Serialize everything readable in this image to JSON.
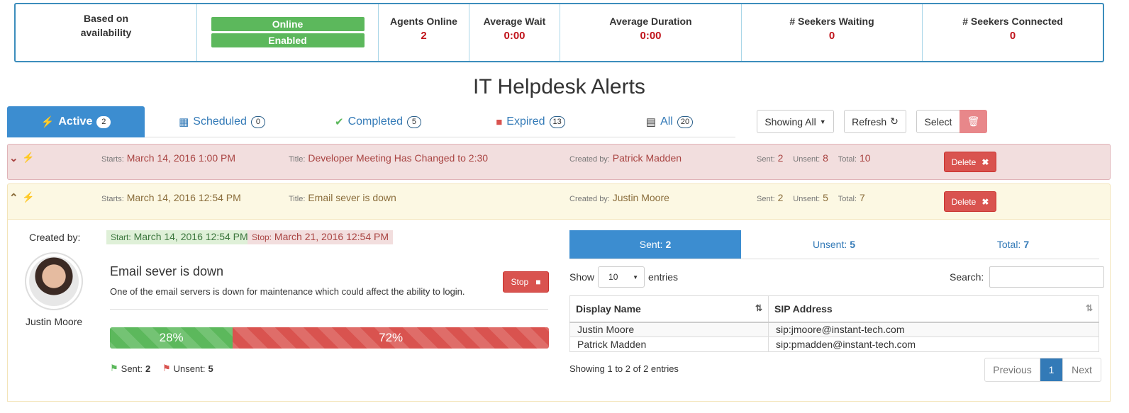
{
  "status_bar": {
    "availability_label": "Based on availability",
    "online_label": "Online",
    "enabled_label": "Enabled",
    "agents_online": {
      "label": "Agents Online",
      "value": "2"
    },
    "average_wait": {
      "label": "Average Wait",
      "value": "0:00"
    },
    "average_duration": {
      "label": "Average Duration",
      "value": "0:00"
    },
    "seekers_waiting": {
      "label": "# Seekers Waiting",
      "value": "0"
    },
    "seekers_connected": {
      "label": "# Seekers Connected",
      "value": "0"
    }
  },
  "page_title": "IT Helpdesk Alerts",
  "tabs": [
    {
      "label": "Active",
      "count": "2",
      "icon": "bolt-icon"
    },
    {
      "label": "Scheduled",
      "count": "0",
      "icon": "calendar-icon"
    },
    {
      "label": "Completed",
      "count": "5",
      "icon": "check-icon"
    },
    {
      "label": "Expired",
      "count": "13",
      "icon": "stop-square-icon"
    },
    {
      "label": "All",
      "count": "20",
      "icon": "list-icon"
    }
  ],
  "toolbar": {
    "showing_label": "Showing All",
    "refresh_label": "Refresh",
    "select_label": "Select"
  },
  "alerts": [
    {
      "starts_label": "Starts:",
      "starts": "March 14, 2016 1:00 PM",
      "title_label": "Title:",
      "title": "Developer Meeting Has Changed to 2:30",
      "created_label": "Created by:",
      "created_by": "Patrick Madden",
      "sent_label": "Sent:",
      "sent": "2",
      "unsent_label": "Unsent:",
      "unsent": "8",
      "total_label": "Total:",
      "total": "10",
      "delete_label": "Delete"
    },
    {
      "starts_label": "Starts:",
      "starts": "March 14, 2016 12:54 PM",
      "title_label": "Title:",
      "title": "Email sever is down",
      "created_label": "Created by:",
      "created_by": "Justin Moore",
      "sent_label": "Sent:",
      "sent": "2",
      "unsent_label": "Unsent:",
      "unsent": "5",
      "total_label": "Total:",
      "total": "7",
      "delete_label": "Delete"
    }
  ],
  "detail": {
    "created_by_label": "Created by:",
    "person_name": "Justin Moore",
    "start_label": "Start:",
    "start": "March 14, 2016 12:54 PM",
    "stop_label": "Stop:",
    "stop": "March 21, 2016 12:54 PM",
    "message_title": "Email sever is down",
    "message_body": "One of the email servers is down for maintenance which could affect the ability to login.",
    "stop_button": "Stop",
    "sent_percent_label": "28%",
    "unsent_percent_label": "72%",
    "sent_fraction": 0.28,
    "legend_sent_label": "Sent:",
    "legend_sent": "2",
    "legend_unsent_label": "Unsent:",
    "legend_unsent": "5"
  },
  "recipients": {
    "tabs": [
      {
        "label": "Sent:",
        "count": "2"
      },
      {
        "label": "Unsent:",
        "count": "5"
      },
      {
        "label": "Total:",
        "count": "7"
      }
    ],
    "show_label": "Show",
    "entries_value": "10",
    "entries_label": "entries",
    "search_label": "Search:",
    "columns": [
      "Display Name",
      "SIP Address"
    ],
    "rows": [
      [
        "Justin Moore",
        "sip:jmoore@instant-tech.com"
      ],
      [
        "Patrick Madden",
        "sip:pmadden@instant-tech.com"
      ]
    ],
    "info": "Showing 1 to 2 of 2 entries",
    "pager": {
      "previous": "Previous",
      "current": "1",
      "next": "Next"
    }
  },
  "colors": {
    "primary": "#3c8dd0",
    "danger": "#d9534f",
    "success": "#5cb85c",
    "value_red": "#c0141b"
  }
}
